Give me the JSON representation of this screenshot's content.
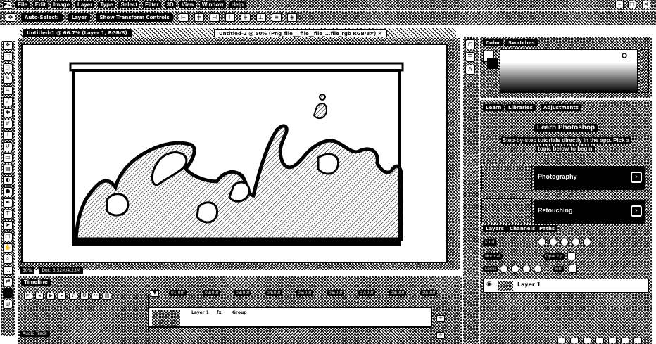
{
  "app": {
    "logo_text": "Ps"
  },
  "menu": [
    "File",
    "Edit",
    "Image",
    "Layer",
    "Type",
    "Select",
    "Filter",
    "3D",
    "View",
    "Window",
    "Help"
  ],
  "window_controls": [
    "–",
    "□",
    "×"
  ],
  "options_bar": {
    "items": [
      "Auto-Select:",
      "Layer",
      "Show Transform Controls"
    ]
  },
  "tabs": [
    {
      "label": "Untitled-1 @ 66.7% (Layer 1, RGB/8)",
      "active": false
    },
    {
      "label": "Untitled-2 @ 50% (Png_file___file__file_...file_rgb RGB/8#) ×",
      "active": true
    }
  ],
  "canvas_status": [
    "50%",
    "Doc: 3.52M/4.23M"
  ],
  "timeline": {
    "title": "Timeline",
    "ticks": [
      "01:00f",
      "02:00f",
      "03:00f",
      "04:00f",
      "05:00f",
      "06:00f",
      "07:00f",
      "08:00f",
      "09:00f"
    ],
    "clip_labels": [
      "Layer 1",
      "fx",
      "Group"
    ],
    "audio_label": "Audio Track"
  },
  "color_panel": {
    "tabs": [
      "Color",
      "Swatches"
    ]
  },
  "learn_panel": {
    "tabs": [
      "Learn",
      "Libraries",
      "Adjustments"
    ],
    "heading": "Learn Photoshop",
    "subtitle_line1": "Step-by-step tutorials directly in the app. Pick a",
    "subtitle_line2": "topic below to begin.",
    "cards": [
      {
        "label": "Photography",
        "arrow": "›"
      },
      {
        "label": "Retouching",
        "arrow": "›"
      }
    ]
  },
  "layers_panel": {
    "tabs": [
      "Layers",
      "Channels",
      "Paths"
    ],
    "kind_label": "Kind",
    "blend_mode": "Normal",
    "opacity_label": "Opacity:",
    "lock_label": "Lock:",
    "fill_label": "Fill:",
    "layer_name": "Layer 1"
  }
}
